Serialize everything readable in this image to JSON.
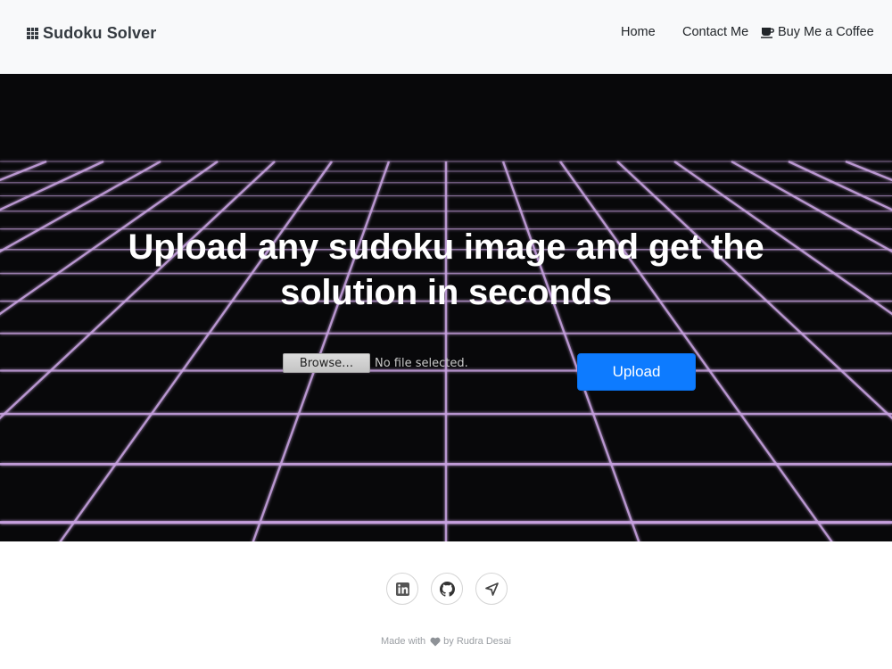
{
  "navbar": {
    "brand": "Sudoku Solver",
    "brand_icon": "grid-icon",
    "links": [
      {
        "label": "Home"
      },
      {
        "label": "Contact Me"
      },
      {
        "label": "Buy Me a Coffee",
        "icon": "coffee-icon"
      }
    ]
  },
  "hero": {
    "title_line1": "Upload any sudoku image and get the",
    "title_line2": "solution in  seconds",
    "file_input": {
      "browse_label": "Browse…",
      "status": "No file selected."
    },
    "upload_label": "Upload",
    "grid_color": "#c8a2e0",
    "background": "#08080a"
  },
  "footer": {
    "social": [
      {
        "name": "linkedin-icon"
      },
      {
        "name": "github-icon"
      },
      {
        "name": "location-arrow-icon"
      }
    ],
    "credit_prefix": "Made with",
    "credit_icon": "heart-icon",
    "credit_suffix": "by Rudra Desai"
  },
  "colors": {
    "accent": "#0d7bff",
    "navbar_bg": "#f8f9fa"
  }
}
